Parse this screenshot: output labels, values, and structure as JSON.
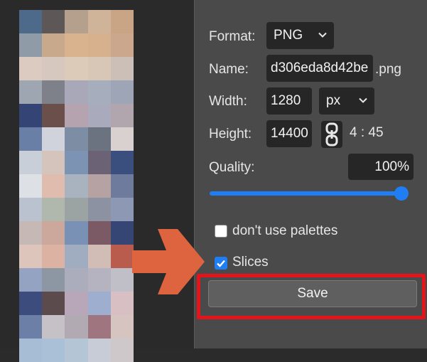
{
  "mosaic_colors": [
    "#4d6a8b",
    "#5e5757",
    "#b5a08e",
    "#cfb49a",
    "#c9a585",
    "#8f9ca7",
    "#c8a98c",
    "#d9b38e",
    "#d7b08d",
    "#caa78d",
    "#dccbc0",
    "#d6c8bf",
    "#dccbb9",
    "#d8c6b7",
    "#ccbfb8",
    "#9da6b1",
    "#7e808a",
    "#a9a8b8",
    "#a6aebe",
    "#9ea5b6",
    "#344575",
    "#6a4f4b",
    "#b5a4b0",
    "#a9abbc",
    "#b1a6ae",
    "#6a7fa5",
    "#d1d3dc",
    "#7d8da4",
    "#6b7280",
    "#d8d1cf",
    "#c8cfd8",
    "#d5c4bc",
    "#7d93b3",
    "#6b6275",
    "#3a4f7d",
    "#dde0e4",
    "#dfbcad",
    "#a9b2bf",
    "#b7a2a3",
    "#6e7b9c",
    "#b9c2ce",
    "#b0b8ad",
    "#9ca3a3",
    "#8d92a3",
    "#8d98b5",
    "#c6b8b5",
    "#cca79c",
    "#7891b4",
    "#7b5a66",
    "#354675",
    "#ddc5bb",
    "#dcb3a3",
    "#a0adc1",
    "#d2bcb6",
    "#b95c4e",
    "#94a3c1",
    "#8d96a3",
    "#acadbc",
    "#b6b3c0",
    "#c0bfc8",
    "#3b4c7d",
    "#5c4b4d",
    "#b8a7b9",
    "#9eaecf",
    "#d7bfc3",
    "#6c80a7",
    "#c5c1c7",
    "#b1aab3",
    "#9f7580",
    "#d5c4c0",
    "#a7bdd6",
    "#a9c0d6",
    "#b4c5d6",
    "#c7ccd6",
    "#cfc8ca"
  ],
  "form": {
    "format_label": "Format:",
    "format_value": "PNG",
    "name_label": "Name:",
    "name_value": "d306eda8d42be",
    "name_suffix": ".png",
    "width_label": "Width:",
    "width_value": "1280",
    "unit_value": "px",
    "height_label": "Height:",
    "height_value": "14400",
    "aspect_ratio": "4 : 45",
    "quality_label": "Quality:",
    "quality_value": "100%",
    "quality_level": 1.0,
    "palette_label": "don't use palettes",
    "palette_checked": false,
    "slices_label": "Slices",
    "slices_checked": true,
    "save_label": "Save"
  },
  "icons": {
    "format_chevron": "chevron-down-icon",
    "unit_chevron": "chevron-down-icon",
    "link": "chain-link-icon",
    "arrow": "right-arrow-icon",
    "check": "checkmark-icon"
  },
  "colors": {
    "accent": "#1f7ef3",
    "highlight": "#e5131a",
    "arrow": "#de6440",
    "panel": "#4a4a4a",
    "field": "#262626"
  }
}
